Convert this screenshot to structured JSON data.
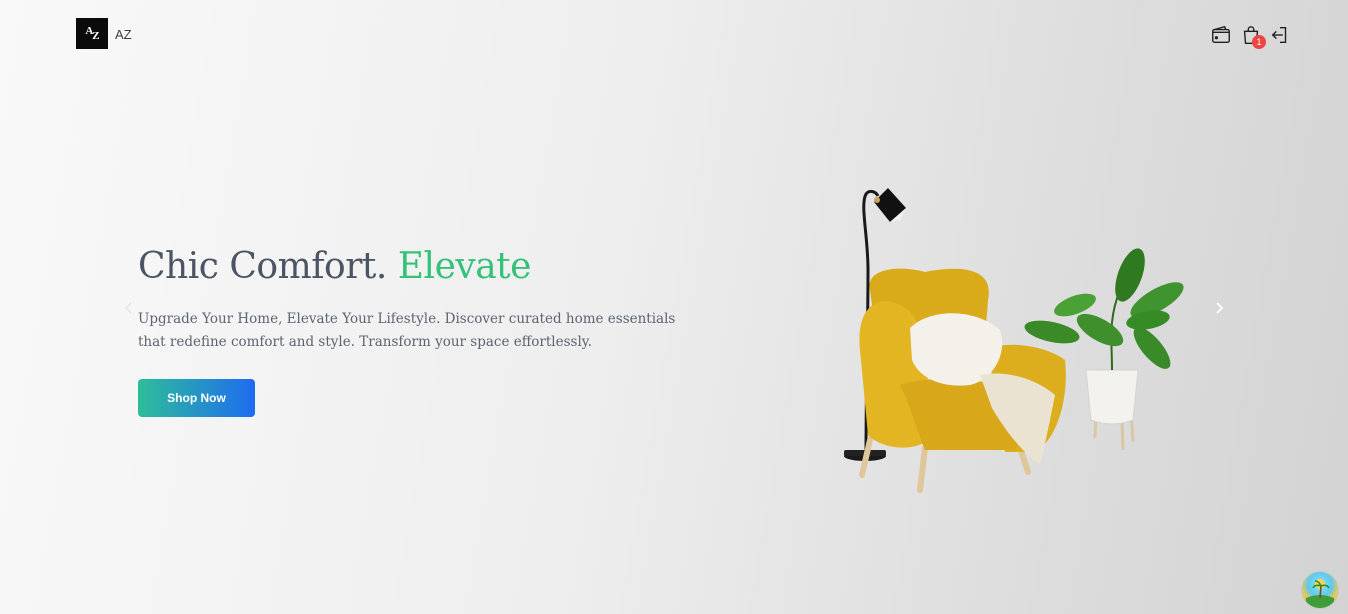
{
  "brand": {
    "logo_mark_a": "A",
    "logo_mark_z": "Z",
    "name": "AZ"
  },
  "nav": {
    "icons": [
      "wallet-icon",
      "shopping-bag-icon",
      "logout-icon"
    ],
    "cart_count": "1"
  },
  "hero": {
    "title_main": "Chic Comfort.",
    "title_accent": "Elevate",
    "description": "Upgrade Your Home, Elevate Your Lifestyle. Discover curated home essentials that redefine comfort and style. Transform your space effortlessly.",
    "cta_label": "Shop Now"
  },
  "colors": {
    "accent_green": "#34c27a",
    "button_gradient_start": "#2ebd9a",
    "button_gradient_end": "#1e6cf0",
    "chair": "#e0b21f",
    "badge": "#ef4444"
  }
}
